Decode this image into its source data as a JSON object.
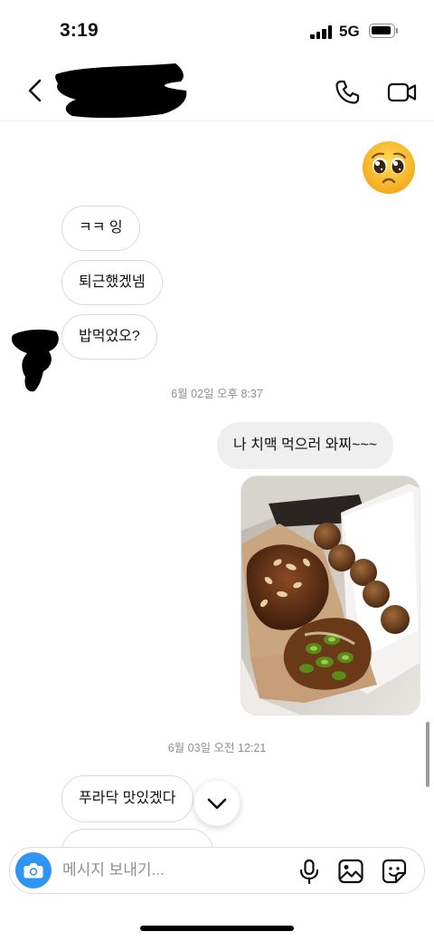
{
  "status_bar": {
    "time": "3:19",
    "network": "5G"
  },
  "header": {
    "contact_name_redacted": true,
    "icons": [
      "back-chevron-icon",
      "phone-icon",
      "video-camera-icon"
    ]
  },
  "messages": [
    {
      "type": "emoji",
      "side": "out",
      "emoji": "pleading-face-icon"
    },
    {
      "type": "text",
      "side": "in",
      "text": "ㅋㅋ 잉"
    },
    {
      "type": "text",
      "side": "in",
      "text": "퇴근했겠넴"
    },
    {
      "type": "text",
      "side": "in",
      "text": "밥먹었오?"
    },
    {
      "type": "timestamp",
      "text": "6월 02일 오후 8:37"
    },
    {
      "type": "text",
      "side": "out",
      "text": "나 치맥 먹으러 와찌~~~"
    },
    {
      "type": "photo",
      "side": "out",
      "subject": "fried chicken and cheese balls in takeout box"
    },
    {
      "type": "timestamp",
      "text": "6월 03일 오전 12:21"
    },
    {
      "type": "text",
      "side": "in",
      "text": "푸라닥 맛있겠다"
    }
  ],
  "composer": {
    "placeholder": "메시지 보내기...",
    "value": ""
  },
  "colors": {
    "camera_button": "#2f95f4",
    "bubble_in_border": "#dbdbdb",
    "bubble_out_bg": "#efefef",
    "timestamp": "#8e8e8e"
  }
}
